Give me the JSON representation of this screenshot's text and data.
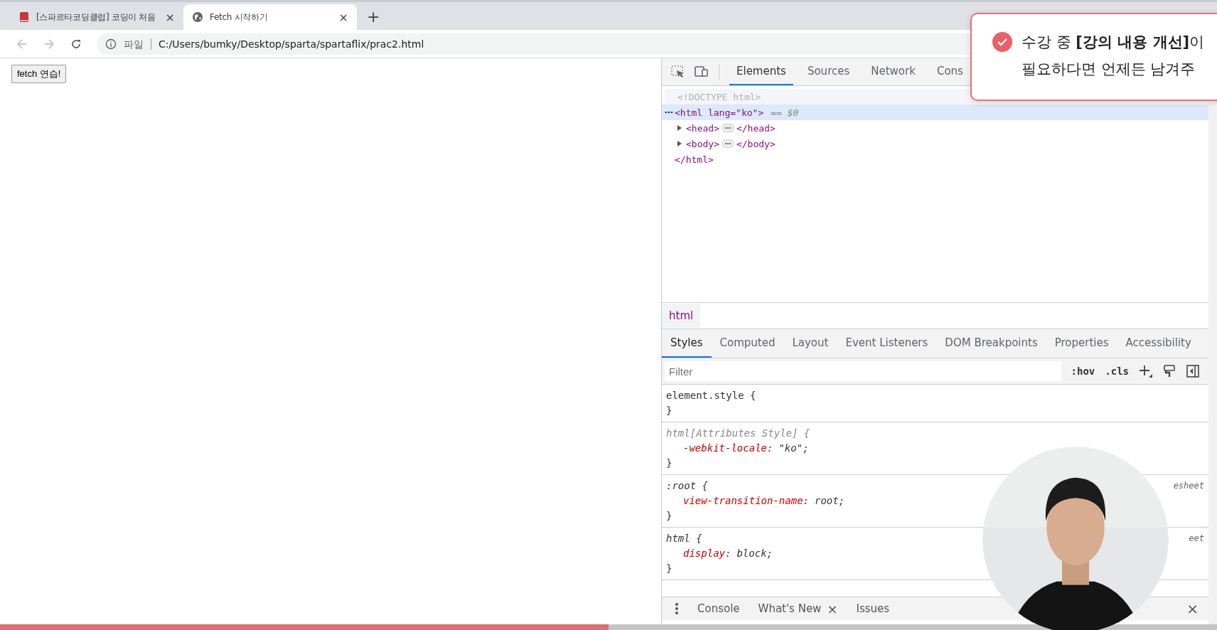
{
  "browser": {
    "tabs": [
      {
        "title": "[스파르타코딩클럽] 코딩이 처음",
        "close": "×",
        "selected": false
      },
      {
        "title": "Fetch 시작하기",
        "close": "×",
        "selected": true
      }
    ],
    "new_tab": "+",
    "address": {
      "scheme": "파일",
      "url": "C:/Users/bumky/Desktop/sparta/spartaflix/prac2.html"
    }
  },
  "page": {
    "button": "fetch 연습!"
  },
  "devtools": {
    "tabs": [
      {
        "label": "Elements",
        "selected": true
      },
      {
        "label": "Sources",
        "selected": false
      },
      {
        "label": "Network",
        "selected": false
      },
      {
        "label": "Cons",
        "selected": false
      }
    ],
    "dom": [
      {
        "kind": "doctype",
        "open": "<!DOCTYPE html>",
        "selected": false
      },
      {
        "kind": "element",
        "open": "<html lang=\"ko\">",
        "suffix": "== $0",
        "close": "</html>",
        "selected": true,
        "expanded": true,
        "children": [
          {
            "kind": "element",
            "open": "<head>",
            "close": "</head>",
            "selected": false,
            "expanded": false
          },
          {
            "kind": "element",
            "open": "<body>",
            "close": "</body>",
            "selected": false,
            "expanded": false
          }
        ]
      }
    ],
    "breadcrumb": "html",
    "style_tabs": [
      {
        "label": "Styles",
        "selected": true
      },
      {
        "label": "Computed",
        "selected": false
      },
      {
        "label": "Layout",
        "selected": false
      },
      {
        "label": "Event Listeners",
        "selected": false
      },
      {
        "label": "DOM Breakpoints",
        "selected": false
      },
      {
        "label": "Properties",
        "selected": false
      },
      {
        "label": "Accessibility",
        "selected": false
      }
    ],
    "filter": {
      "placeholder": "Filter",
      "hov": ":hov",
      "cls": ".cls"
    },
    "rules": [
      {
        "selector": "element.style {",
        "italic": false,
        "close": "}"
      },
      {
        "selector": "html[Attributes Style] {",
        "italic": true,
        "declarations": [
          {
            "property": "-webkit-locale:",
            "value": "\"ko\";"
          }
        ],
        "close": "}"
      },
      {
        "selector": ":root {",
        "italic": true,
        "source": "esheet",
        "declarations": [
          {
            "property": "view-transition-name:",
            "value": "root;"
          }
        ],
        "close": "}"
      },
      {
        "selector": "html {",
        "italic": true,
        "source": "eet",
        "declarations": [
          {
            "property": "display:",
            "value": "block;"
          }
        ],
        "close": "}"
      }
    ],
    "drawer": {
      "tabs": [
        {
          "label": "Console",
          "closable": false,
          "selected": false
        },
        {
          "label": "What's New",
          "closable": true,
          "close": "×",
          "selected": false
        },
        {
          "label": "Issues",
          "closable": false,
          "selected": false
        }
      ],
      "close": "×"
    }
  },
  "toast": {
    "lines": [
      "수강 중 **[강의 내용 개선]**이",
      "필요하다면 언제든 남겨주"
    ]
  },
  "video": {
    "level": 0.5
  }
}
